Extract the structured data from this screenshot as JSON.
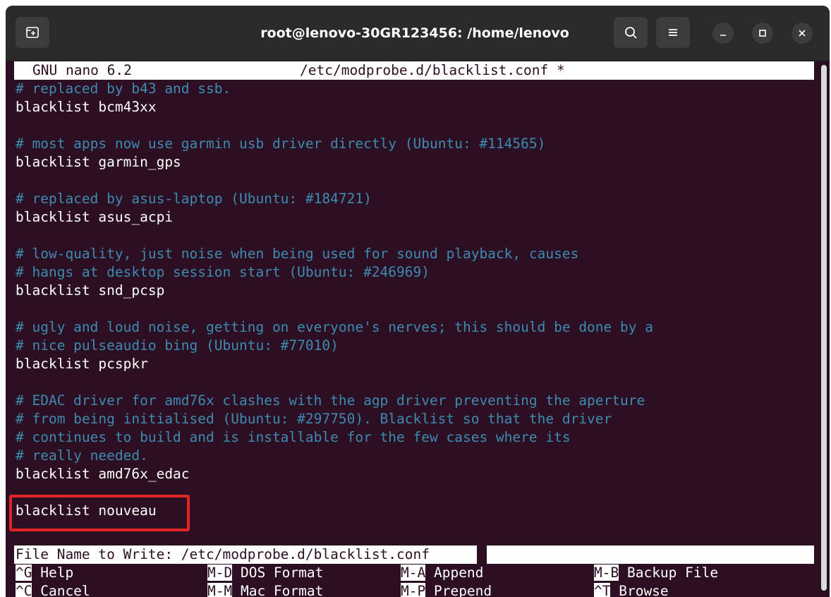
{
  "window": {
    "title": "root@lenovo-30GR123456: /home/lenovo",
    "new_tab_icon": "new-tab-icon",
    "search_icon": "search-icon",
    "menu_icon": "hamburger-menu-icon",
    "minimize_icon": "minimize-icon",
    "maximize_icon": "maximize-icon",
    "close_icon": "close-icon"
  },
  "nano": {
    "version": "GNU nano 6.2",
    "file_path": "/etc/modprobe.d/blacklist.conf *",
    "lines": [
      {
        "text": "# replaced by b43 and ssb.",
        "type": "comment"
      },
      {
        "text": "blacklist bcm43xx",
        "type": "code"
      },
      {
        "text": "",
        "type": "code"
      },
      {
        "text": "# most apps now use garmin usb driver directly (Ubuntu: #114565)",
        "type": "comment"
      },
      {
        "text": "blacklist garmin_gps",
        "type": "code"
      },
      {
        "text": "",
        "type": "code"
      },
      {
        "text": "# replaced by asus-laptop (Ubuntu: #184721)",
        "type": "comment"
      },
      {
        "text": "blacklist asus_acpi",
        "type": "code"
      },
      {
        "text": "",
        "type": "code"
      },
      {
        "text": "# low-quality, just noise when being used for sound playback, causes",
        "type": "comment"
      },
      {
        "text": "# hangs at desktop session start (Ubuntu: #246969)",
        "type": "comment"
      },
      {
        "text": "blacklist snd_pcsp",
        "type": "code"
      },
      {
        "text": "",
        "type": "code"
      },
      {
        "text": "# ugly and loud noise, getting on everyone's nerves; this should be done by a",
        "type": "comment"
      },
      {
        "text": "# nice pulseaudio bing (Ubuntu: #77010)",
        "type": "comment"
      },
      {
        "text": "blacklist pcspkr",
        "type": "code"
      },
      {
        "text": "",
        "type": "code"
      },
      {
        "text": "# EDAC driver for amd76x clashes with the agp driver preventing the aperture",
        "type": "comment"
      },
      {
        "text": "# from being initialised (Ubuntu: #297750). Blacklist so that the driver",
        "type": "comment"
      },
      {
        "text": "# continues to build and is installable for the few cases where its",
        "type": "comment"
      },
      {
        "text": "# really needed.",
        "type": "comment"
      },
      {
        "text": "blacklist amd76x_edac",
        "type": "code"
      },
      {
        "text": "",
        "type": "code"
      },
      {
        "text": "blacklist nouveau",
        "type": "code"
      }
    ],
    "prompt": "File Name to Write: /etc/modprobe.d/blacklist.conf",
    "shortcuts": [
      {
        "key": "^G",
        "label": " Help"
      },
      {
        "key": "M-D",
        "label": " DOS Format"
      },
      {
        "key": "M-A",
        "label": " Append"
      },
      {
        "key": "M-B",
        "label": " Backup File"
      },
      {
        "key": "^C",
        "label": " Cancel"
      },
      {
        "key": "M-M",
        "label": " Mac Format"
      },
      {
        "key": "M-P",
        "label": " Prepend"
      },
      {
        "key": "^T",
        "label": " Browse"
      }
    ]
  },
  "colors": {
    "terminal_bg": "#2c0f22",
    "comment": "#3d8bb0",
    "highlight_box": "#e02424"
  }
}
